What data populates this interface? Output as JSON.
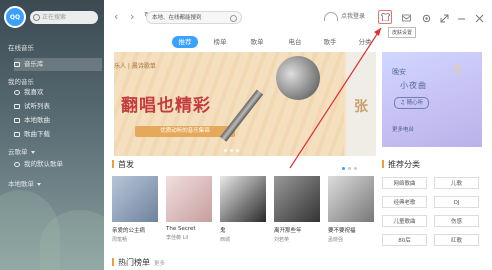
{
  "sidebar": {
    "logo_text": "QQ",
    "search_placeholder": "正在搜索",
    "section_online": "在线音乐",
    "section_mine": "我的音乐",
    "section_cloud": "云歌单",
    "section_local": "本地歌单",
    "online_items": [
      {
        "label": "音乐库",
        "icon": "music-library-icon"
      }
    ],
    "mine_items": [
      {
        "label": "我喜欢",
        "icon": "heart-icon"
      },
      {
        "label": "试听列表",
        "icon": "list-icon"
      },
      {
        "label": "本地歌曲",
        "icon": "computer-icon"
      },
      {
        "label": "歌曲下载",
        "icon": "download-icon"
      }
    ],
    "cloud_items": [
      {
        "label": "我的默认歌单",
        "icon": "playlist-icon"
      }
    ]
  },
  "topbar": {
    "back": "‹",
    "forward": "›",
    "refresh": "↻",
    "search_value": "本地、在线都能搜到",
    "login_text": "点我登录",
    "tooltip": "皮肤设置"
  },
  "tabs": [
    "推荐",
    "榜单",
    "歌单",
    "电台",
    "歌手",
    "分类"
  ],
  "banner": {
    "tag": "乐人 | 晨诗歌单",
    "title": "翻唱也精彩",
    "subtitle": "优质动听的音乐集锦",
    "side_text": "张"
  },
  "card": {
    "line1": "晚安",
    "line2": "小夜曲",
    "pill": "♫ 随心听",
    "more": "更多电台"
  },
  "new_release": {
    "title": "首发",
    "albums": [
      {
        "title": "亲爱的公主病",
        "artist": "周笔畅",
        "color": "#8a9bb2"
      },
      {
        "title": "The Secret",
        "artist": "李佳薇 Lil",
        "color": "#d9b7b6"
      },
      {
        "title": "鬼",
        "artist": "西城",
        "color": "#4a4a4a"
      },
      {
        "title": "离开那些年",
        "artist": "刘若英",
        "color": "#6b6b6b"
      },
      {
        "title": "要不要祝福",
        "artist": "孟晓强",
        "color": "#9a9a9a"
      }
    ]
  },
  "recommend": {
    "title": "推荐分类",
    "items": [
      "网络歌曲",
      "儿歌",
      "经典老歌",
      "DJ",
      "儿童歌曲",
      "伤感",
      "80后",
      "红歌"
    ]
  },
  "hot_chart": {
    "title": "热门榜单",
    "more": "更多"
  },
  "colors": {
    "accent": "#3aa1ff",
    "highlight": "#f0a030",
    "arrow": "#e03030"
  }
}
